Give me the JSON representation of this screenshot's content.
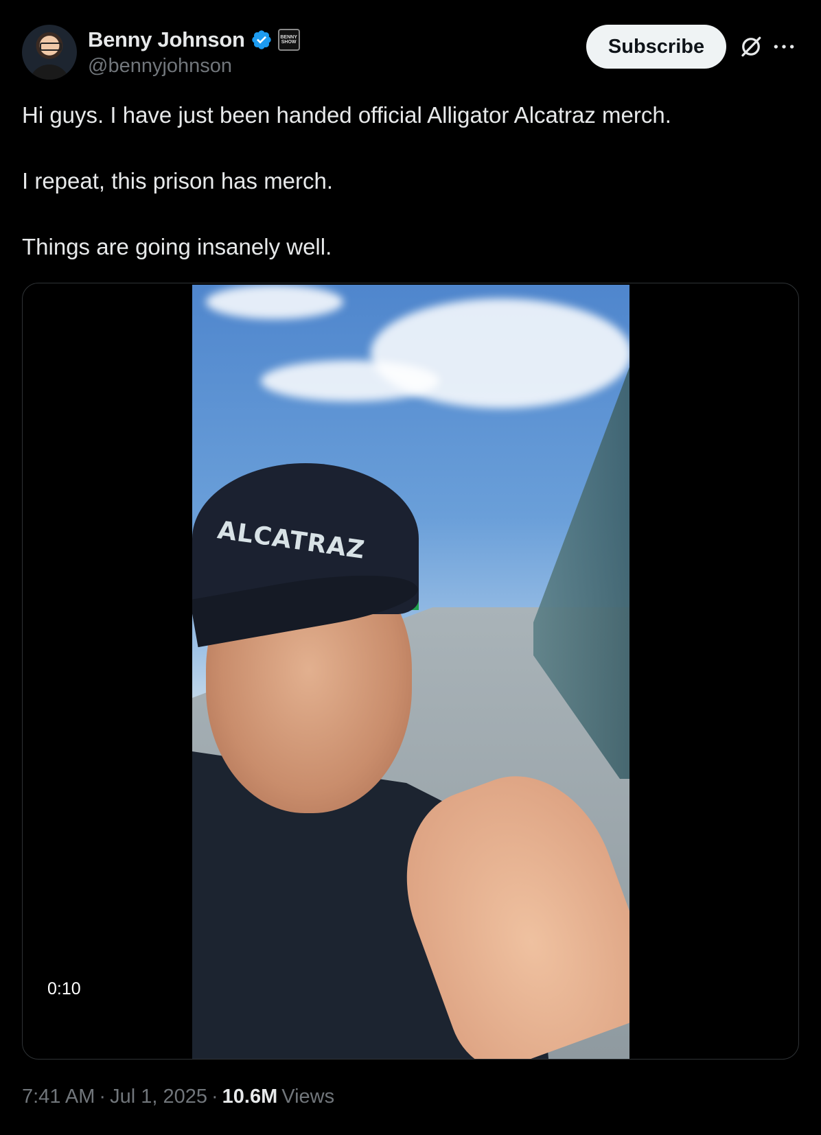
{
  "author": {
    "display_name": "Benny Johnson",
    "handle": "@bennyjohnson",
    "affiliate_badge_text": "BENNY SHOW",
    "avatar_icon": "profile-photo-icon"
  },
  "header": {
    "subscribe_label": "Subscribe",
    "grok_icon": "grok-icon",
    "more_icon": "more-icon"
  },
  "tweet": {
    "paragraphs": [
      "Hi guys. I have just been handed official Alligator Alcatraz merch.",
      "I repeat, this prison has merch.",
      "Things are going insanely well."
    ]
  },
  "media": {
    "type": "video",
    "duration": "0:10",
    "cap_text": "ALCATRAZ"
  },
  "footer": {
    "time": "7:41 AM",
    "separator": "·",
    "date": "Jul 1, 2025",
    "views_count": "10.6M",
    "views_label": "Views"
  },
  "colors": {
    "verified": "#1d9bf0",
    "text_primary": "#e7e9ea",
    "text_secondary": "#71767b",
    "background": "#000000"
  }
}
